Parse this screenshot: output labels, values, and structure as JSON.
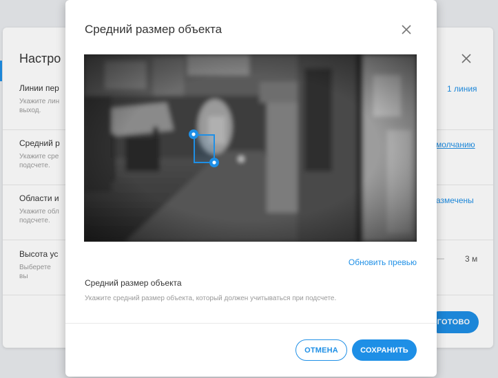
{
  "background": {
    "title": "Настро",
    "sections": [
      {
        "title": "Линии пер",
        "desc": "Укажите лин выход.",
        "link": "1 линия"
      },
      {
        "title": "Средний р",
        "desc": "Укажите сре подсчете.",
        "link": "молчанию"
      },
      {
        "title": "Области и",
        "desc": "Укажите обл подсчете.",
        "link": "азмечены"
      },
      {
        "title": "Высота ус",
        "desc": "Выберете вы",
        "value": "3 м"
      }
    ],
    "done_label": "ГОТОВО"
  },
  "modal": {
    "title": "Средний размер объекта",
    "refresh_label": "Обновить превью",
    "field_title": "Средний размер объекта",
    "field_desc": "Укажите средний размер объекта, который должен учитываться при подсчете.",
    "cancel_label": "ОТМЕНА",
    "save_label": "СОХРАНИТЬ"
  },
  "colors": {
    "accent": "#1e8fe6"
  }
}
